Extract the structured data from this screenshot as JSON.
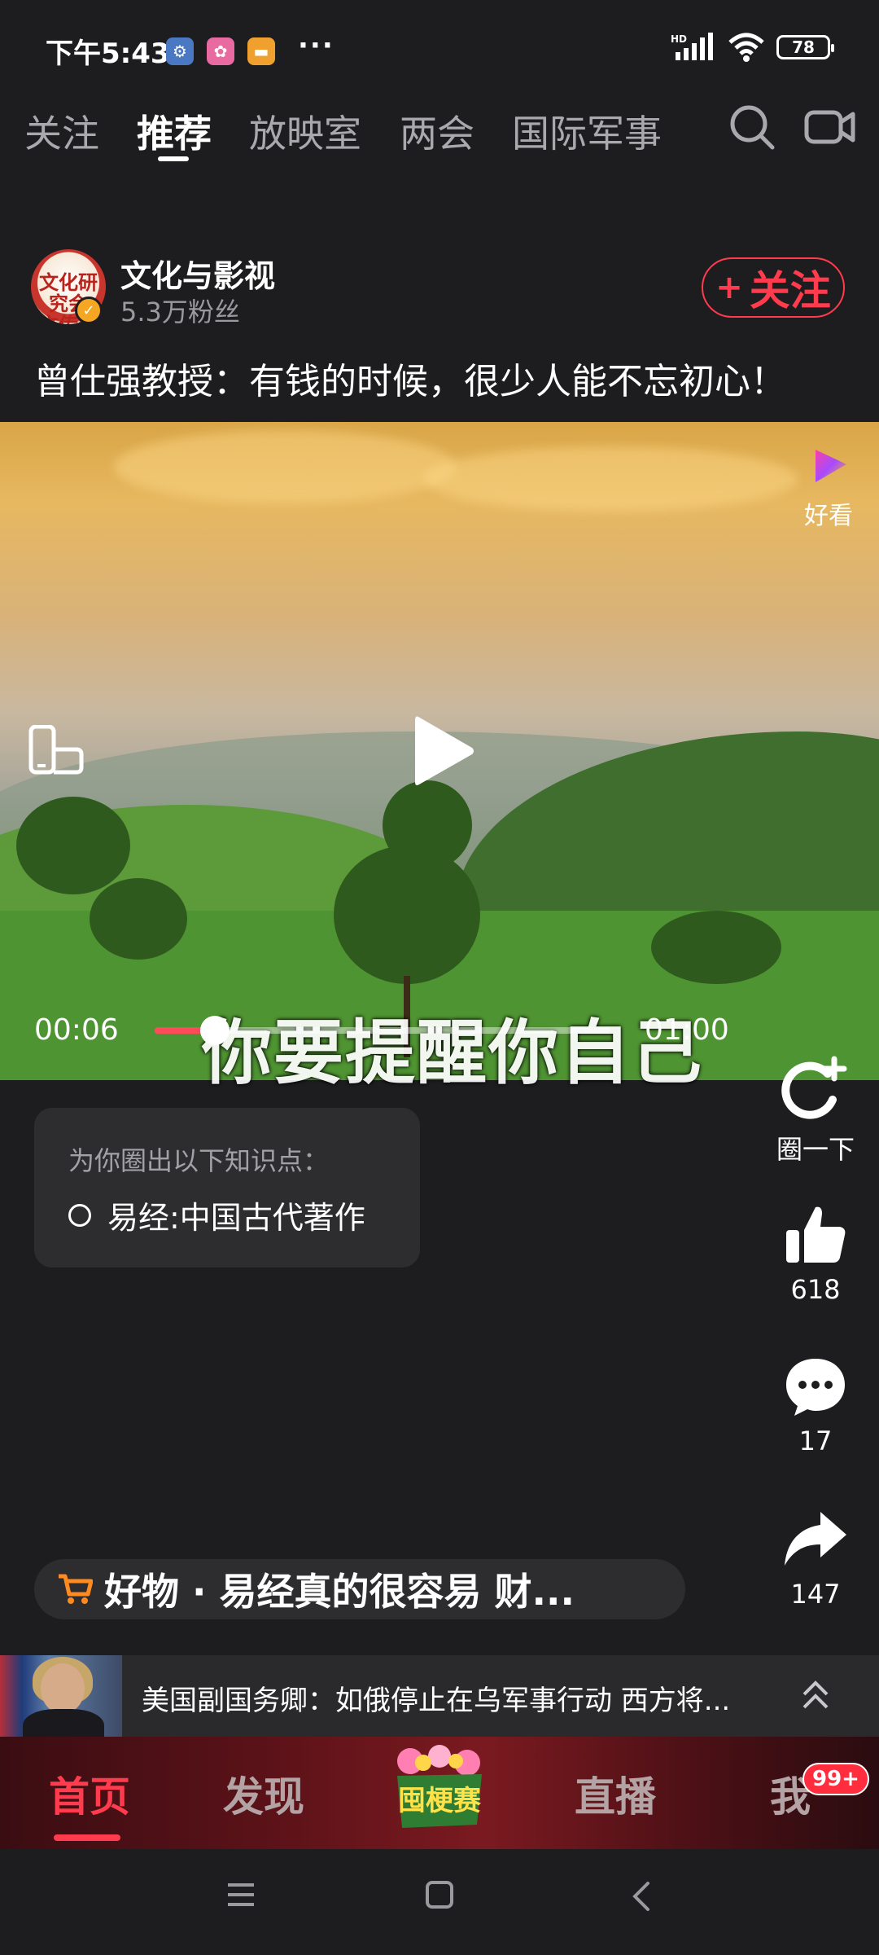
{
  "status_bar": {
    "time": "下午5:43",
    "more": "···",
    "battery": "78",
    "notif_icons": [
      "settings-notif-icon",
      "app-notif-icon",
      "message-notif-icon"
    ],
    "signal_icons": [
      "hd-signal-icon",
      "wifi-icon",
      "battery-icon"
    ]
  },
  "top_tabs": {
    "items": [
      "关注",
      "推荐",
      "放映室",
      "两会",
      "国际军事"
    ],
    "active_index": 1,
    "icons": [
      "search-icon",
      "camera-icon"
    ]
  },
  "author": {
    "name": "文化与影视",
    "fans": "5.3万粉丝",
    "avatar_text": "文化研究会 文传化约",
    "follow_plus": "+",
    "follow_label": "关注"
  },
  "video": {
    "title": "曾仕强教授：有钱的时候，很少人能不忘初心！",
    "subtitle": "你要提醒你自己",
    "current_time": "00:06",
    "total_time": "01:00",
    "progress_fraction": 0.1,
    "brand_label": "好看",
    "icons": [
      "haokan-logo-icon",
      "rotate-screen-icon",
      "play-icon"
    ]
  },
  "knowledge": {
    "header": "为你圈出以下知识点：",
    "items": [
      "易经:中国古代著作"
    ]
  },
  "side_actions": {
    "circle": {
      "label": "圈一下",
      "icon": "circle-add-icon"
    },
    "like": {
      "count": "618",
      "icon": "thumbs-up-icon"
    },
    "comment": {
      "count": "17",
      "icon": "comment-icon"
    },
    "share": {
      "count": "147",
      "icon": "share-icon"
    }
  },
  "shop": {
    "icon": "cart-icon",
    "text": "好物 · 易经真的很容易 财..."
  },
  "news": {
    "text": "美国副国务卿：如俄停止在乌军事行动 西方将...",
    "icon": "chevron-up-double-icon"
  },
  "bottom_nav": {
    "items": [
      "首页",
      "发现",
      "直播",
      "我"
    ],
    "active_index": 0,
    "center_label": "囤梗赛",
    "badge": "99+"
  },
  "system_nav": {
    "icons": [
      "menu-icon",
      "home-icon",
      "back-icon"
    ]
  },
  "colors": {
    "accent": "#ff3b4d",
    "background": "#1d1d1f",
    "card": "#2d2d30",
    "muted_text": "#a9a9ad",
    "verify": "#f5a623"
  }
}
